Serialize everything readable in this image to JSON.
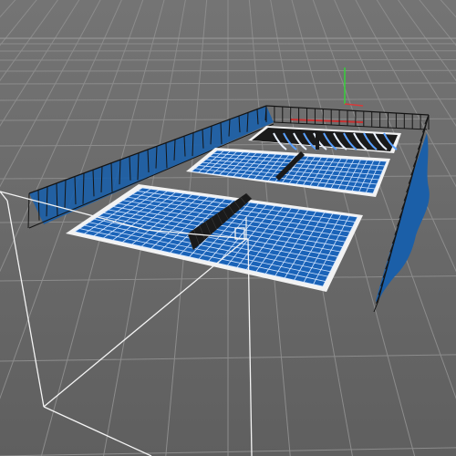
{
  "viewport": {
    "name": "3D viewport",
    "view": "perspective"
  },
  "colors": {
    "background": "#6b6b6b",
    "grid_line": "#8a8a8a",
    "horizon_line": "#9a9a9a",
    "court_fill": "#1a63b8",
    "court_wire": "#d4e6ff",
    "court_surround": "#f2f2f2",
    "wall_wire": "#141414",
    "wall_fill": "#1b5fa8",
    "net": "#1a1a1a",
    "selection_box": "#f4f4f4",
    "axis_y": "#36d13a",
    "axis_x": "#d83a3a"
  },
  "scene": {
    "courts": [
      {
        "name": "near-court"
      },
      {
        "name": "middle-court"
      },
      {
        "name": "far-court"
      }
    ],
    "walls": [
      {
        "name": "left-wall"
      },
      {
        "name": "right-wall"
      },
      {
        "name": "back-wall"
      }
    ]
  }
}
